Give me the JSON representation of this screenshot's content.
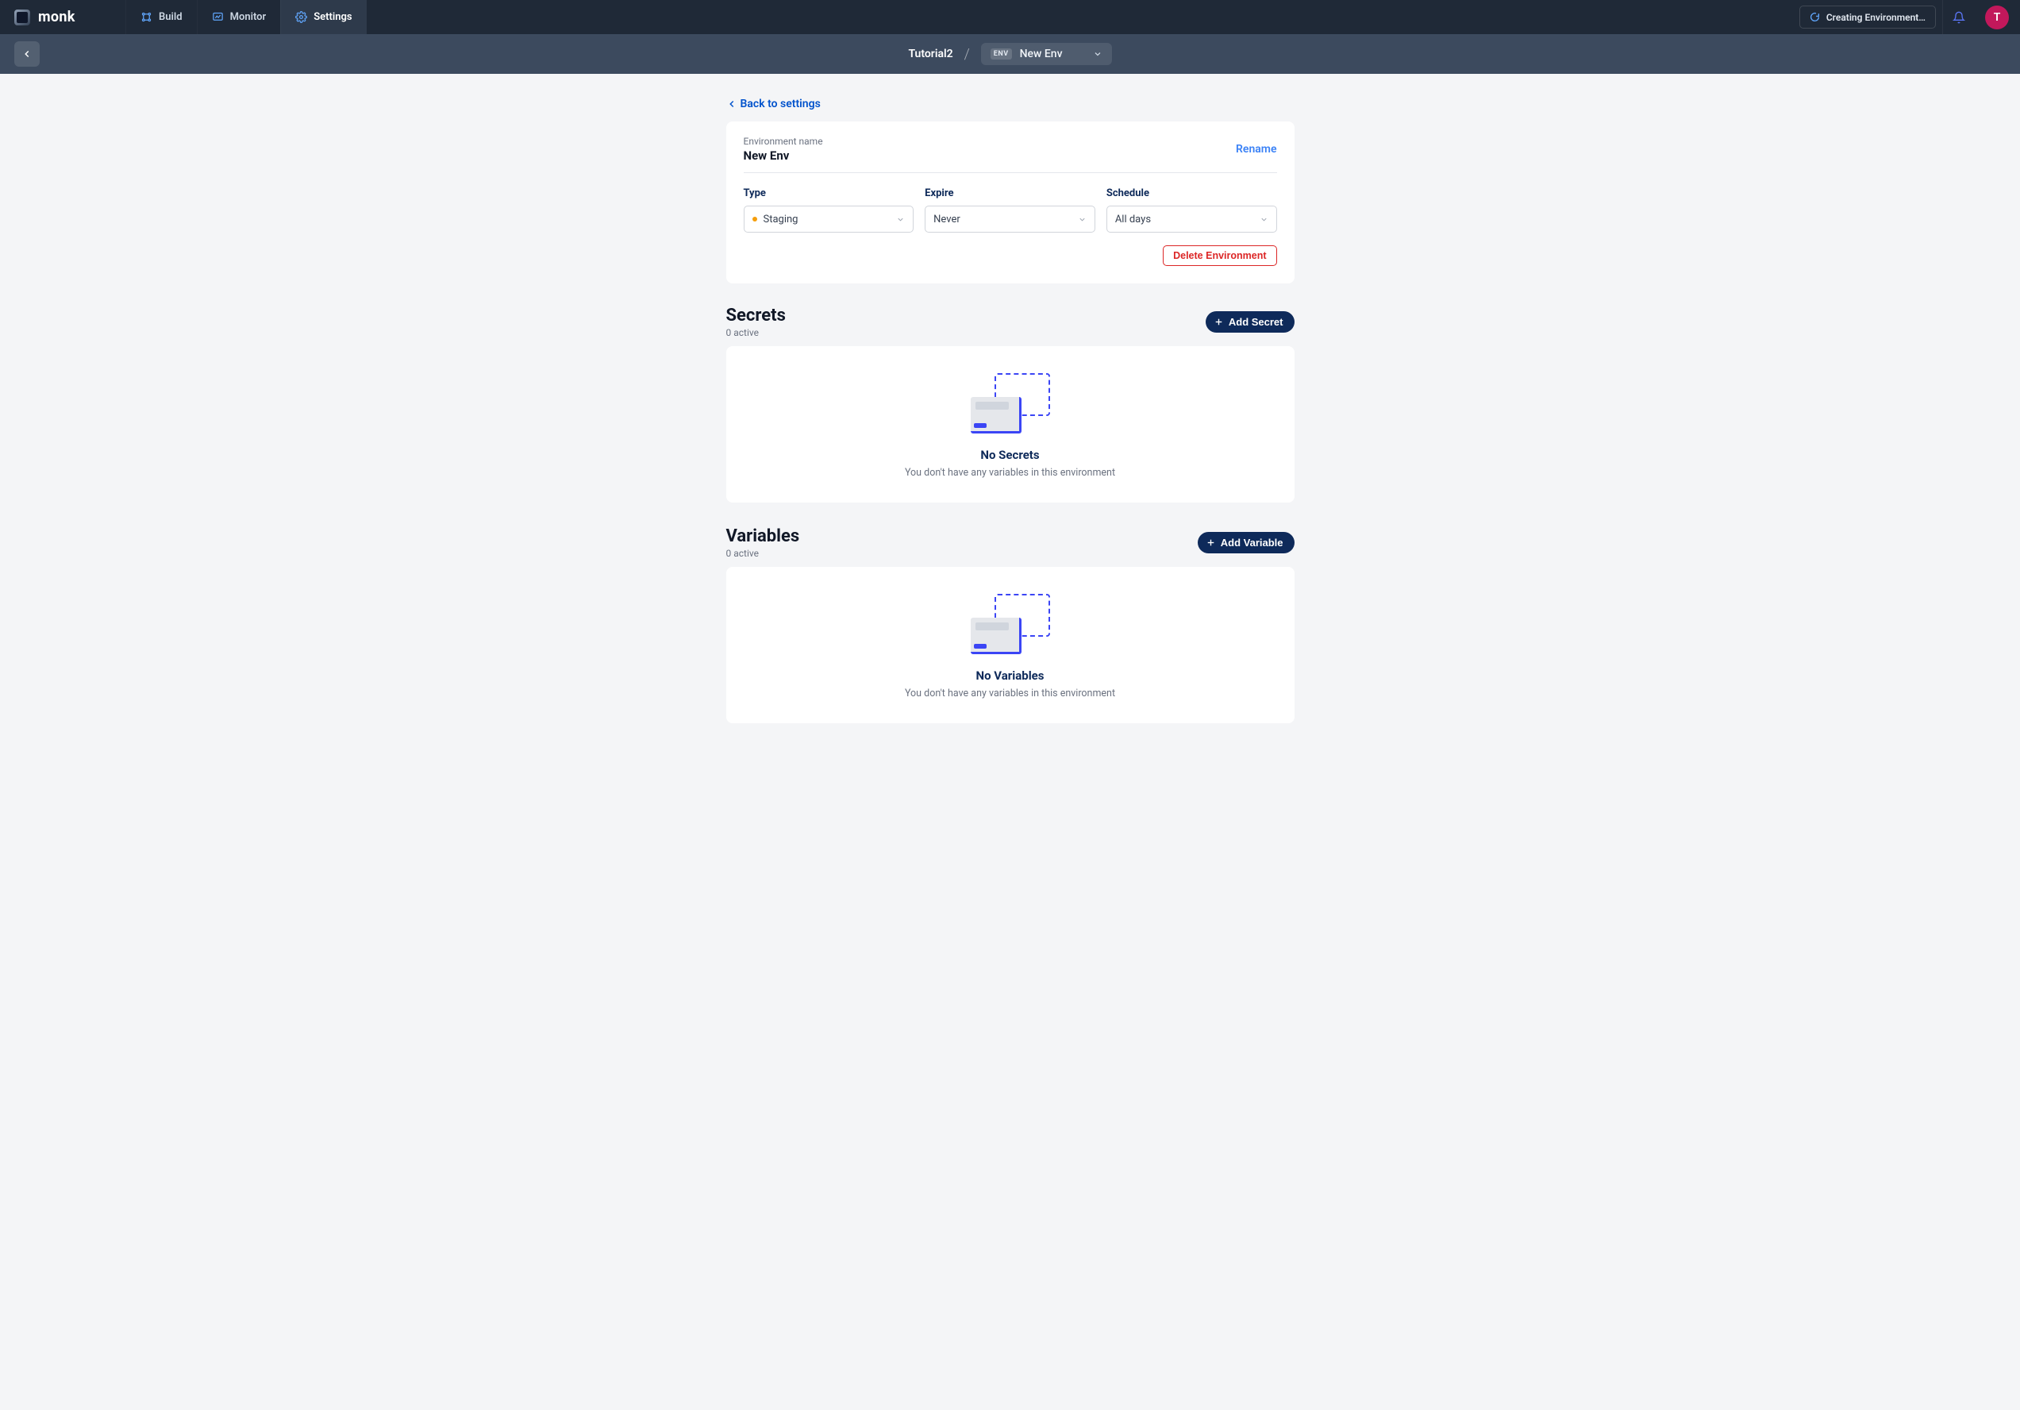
{
  "brand": {
    "name": "monk"
  },
  "nav": {
    "build": "Build",
    "monitor": "Monitor",
    "settings": "Settings",
    "status": "Creating Environment…"
  },
  "avatar": {
    "initial": "T"
  },
  "breadcrumb": {
    "project": "Tutorial2",
    "env_badge": "ENV",
    "env_name": "New Env"
  },
  "back_link": "Back to settings",
  "env_panel": {
    "label": "Environment name",
    "name": "New Env",
    "rename": "Rename",
    "type_label": "Type",
    "type_value": "Staging",
    "expire_label": "Expire",
    "expire_value": "Never",
    "schedule_label": "Schedule",
    "schedule_value": "All days",
    "delete": "Delete Environment"
  },
  "secrets": {
    "title": "Secrets",
    "subtitle": "0 active",
    "add": "Add Secret",
    "empty_title": "No Secrets",
    "empty_sub": "You don't have any variables in this environment"
  },
  "variables": {
    "title": "Variables",
    "subtitle": "0 active",
    "add": "Add Variable",
    "empty_title": "No Variables",
    "empty_sub": "You don't have any variables in this environment"
  }
}
